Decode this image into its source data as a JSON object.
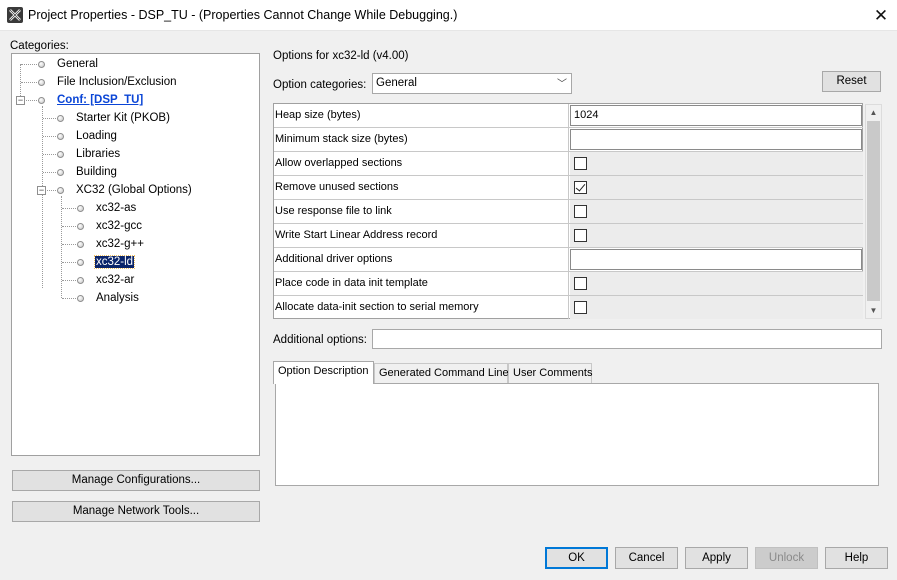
{
  "window": {
    "title": "Project Properties - DSP_TU - (Properties Cannot Change While Debugging.)",
    "app_icon": "x-logo-icon",
    "close_icon": "close-icon"
  },
  "categories": {
    "label": "Categories:",
    "items": [
      {
        "label": "General"
      },
      {
        "label": "File Inclusion/Exclusion"
      },
      {
        "label": "Conf: [DSP_TU]"
      },
      {
        "label": "Starter Kit (PKOB)"
      },
      {
        "label": "Loading"
      },
      {
        "label": "Libraries"
      },
      {
        "label": "Building"
      },
      {
        "label": "XC32 (Global Options)"
      },
      {
        "label": "xc32-as"
      },
      {
        "label": "xc32-gcc"
      },
      {
        "label": "xc32-g++"
      },
      {
        "label": "xc32-ld"
      },
      {
        "label": "xc32-ar"
      },
      {
        "label": "Analysis"
      }
    ],
    "selected": "xc32-ld"
  },
  "side_buttons": {
    "manage_configurations": "Manage Configurations...",
    "manage_network_tools": "Manage Network Tools..."
  },
  "options": {
    "header": "Options for xc32-ld (v4.00)",
    "category_label": "Option categories:",
    "category_value": "General",
    "reset_label": "Reset",
    "rows": [
      {
        "name": "Heap size (bytes)",
        "type": "text",
        "value": "1024"
      },
      {
        "name": "Minimum stack size (bytes)",
        "type": "text",
        "value": ""
      },
      {
        "name": "Allow overlapped sections",
        "type": "checkbox",
        "checked": false
      },
      {
        "name": "Remove unused sections",
        "type": "checkbox",
        "checked": true
      },
      {
        "name": "Use response file to link",
        "type": "checkbox",
        "checked": false
      },
      {
        "name": "Write Start Linear Address record",
        "type": "checkbox",
        "checked": false
      },
      {
        "name": "Additional driver options",
        "type": "text",
        "value": ""
      },
      {
        "name": "Place code in data init template",
        "type": "checkbox",
        "checked": false
      },
      {
        "name": "Allocate data-init section to serial memory",
        "type": "checkbox",
        "checked": false
      }
    ],
    "additional_label": "Additional options:",
    "additional_value": ""
  },
  "tabs": {
    "items": [
      {
        "label": "Option Description"
      },
      {
        "label": "Generated Command Line"
      },
      {
        "label": "User Comments"
      }
    ],
    "active": "Option Description"
  },
  "footer": {
    "ok": "OK",
    "cancel": "Cancel",
    "apply": "Apply",
    "unlock": "Unlock",
    "help": "Help"
  }
}
